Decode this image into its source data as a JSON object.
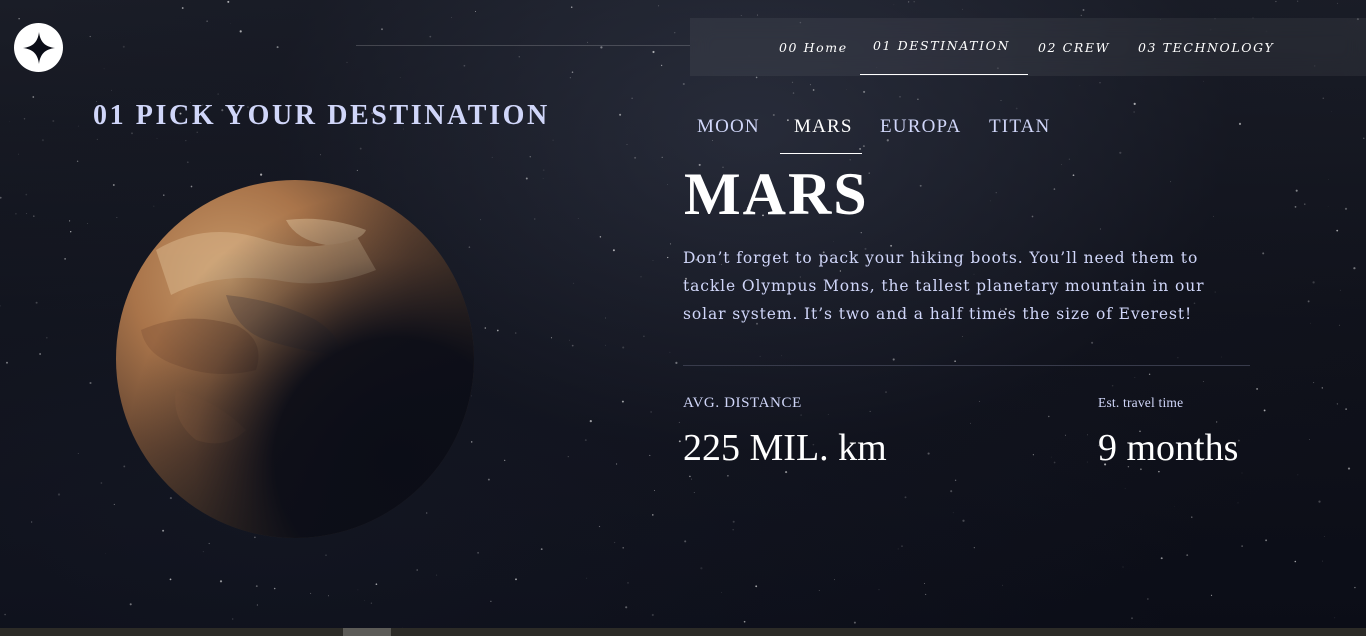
{
  "colors": {
    "accent": "#d0d6f9",
    "text": "#ffffff",
    "background": "#0b0d17",
    "divider": "#383b4b"
  },
  "logo": {
    "icon": "four-point-star-icon"
  },
  "nav": {
    "items": [
      {
        "label": "00 Home",
        "active": false
      },
      {
        "label": "01 DESTINATION",
        "active": true
      },
      {
        "label": "02 CREW",
        "active": false
      },
      {
        "label": "03 TECHNOLOGY",
        "active": false
      }
    ]
  },
  "heading": "01 PICK YOUR DESTINATION",
  "planet_image": {
    "icon": "mars-planet-image"
  },
  "tabs": [
    {
      "label": "MOON",
      "active": false
    },
    {
      "label": "MARS",
      "active": true
    },
    {
      "label": "EUROPA",
      "active": false
    },
    {
      "label": "TITAN",
      "active": false
    }
  ],
  "destination": {
    "name": "MARS",
    "description": "Don’t forget to pack your hiking boots. You’ll need them to tackle Olympus Mons, the tallest planetary mountain in our solar system. It’s two and a half times the size of Everest!",
    "distance_label": "AVG. DISTANCE",
    "distance_value": "225 MIL. km",
    "travel_label": "Est. travel time",
    "travel_value": "9 months"
  }
}
